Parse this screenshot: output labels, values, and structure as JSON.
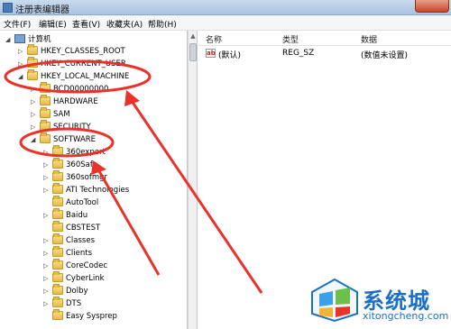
{
  "window": {
    "title": "注册表编辑器"
  },
  "menu": [
    "文件(F)",
    "编辑(E)",
    "查看(V)",
    "收藏夹(A)",
    "帮助(H)"
  ],
  "tree": {
    "root": "计算机",
    "hives": [
      "HKEY_CLASSES_ROOT",
      "HKEY_CURRENT_USER",
      "HKEY_LOCAL_MACHINE"
    ],
    "hklm_children": [
      "BCD00000000",
      "HARDWARE",
      "SAM",
      "SECURITY",
      "SOFTWARE"
    ],
    "software_children": [
      "360expert",
      "360Safe",
      "360sofmgr",
      "ATI Technologies",
      "AutoTool",
      "Baidu",
      "CBSTEST",
      "Classes",
      "Clients",
      "CoreCodec",
      "CyberLink",
      "Dolby",
      "DTS",
      "Easy Sysprep"
    ]
  },
  "list": {
    "columns": [
      "名称",
      "类型",
      "数据"
    ],
    "rows": [
      {
        "name": "(默认)",
        "type": "REG_SZ",
        "data": "(数值未设置)"
      }
    ],
    "icon_text": "ab"
  },
  "annotation": {
    "color": "#e8322a"
  },
  "watermark": {
    "text": "系统城",
    "url": "xitongcheng.com"
  }
}
